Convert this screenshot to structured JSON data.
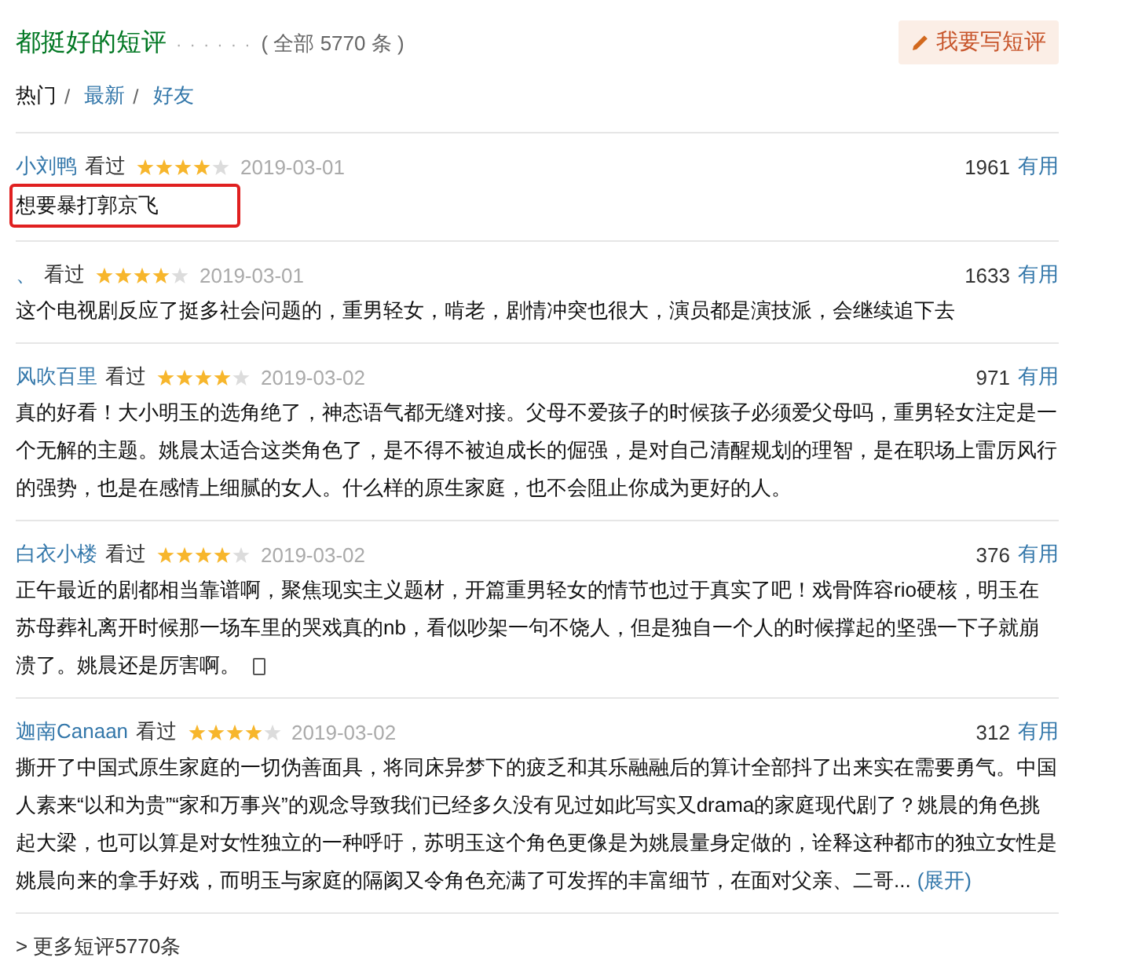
{
  "header": {
    "title": "都挺好的短评",
    "dots": "· · · · · ·",
    "count_link": "( 全部 5770 条 )",
    "write_button": "我要写短评"
  },
  "tabs": [
    {
      "label": "热门",
      "selected": true
    },
    {
      "label": "最新",
      "selected": false
    },
    {
      "label": "好友",
      "selected": false
    }
  ],
  "tab_separators": [
    "/",
    "/"
  ],
  "comments": [
    {
      "user": "小刘鸭",
      "status": "看过",
      "stars": 4,
      "date": "2019-03-01",
      "votes": "1961",
      "useful": "有用",
      "text": "想要暴打郭京飞",
      "highlighted": true
    },
    {
      "user": "、",
      "status": "看过",
      "stars": 4,
      "date": "2019-03-01",
      "votes": "1633",
      "useful": "有用",
      "text": "这个电视剧反应了挺多社会问题的，重男轻女，啃老，剧情冲突也很大，演员都是演技派，会继续追下去",
      "highlighted": false
    },
    {
      "user": "风吹百里",
      "status": "看过",
      "stars": 4,
      "date": "2019-03-02",
      "votes": "971",
      "useful": "有用",
      "text": "真的好看！大小明玉的选角绝了，神态语气都无缝对接。父母不爱孩子的时候孩子必须爱父母吗，重男轻女注定是一个无解的主题。姚晨太适合这类角色了，是不得不被迫成长的倔强，是对自己清醒规划的理智，是在职场上雷厉风行的强势，也是在感情上细腻的女人。什么样的原生家庭，也不会阻止你成为更好的人。",
      "highlighted": false
    },
    {
      "user": "白衣小楼",
      "status": "看过",
      "stars": 4,
      "date": "2019-03-02",
      "votes": "376",
      "useful": "有用",
      "text": "正午最近的剧都相当靠谱啊，聚焦现实主义题材，开篇重男轻女的情节也过于真实了吧！戏骨阵容rio硬核，明玉在苏母葬礼离开时候那一场车里的哭戏真的nb，看似吵架一句不饶人，但是独自一个人的时候撑起的坚强一下子就崩溃了。姚晨还是厉害啊。",
      "highlighted": false,
      "mobile": true
    },
    {
      "user": "迦南Canaan",
      "status": "看过",
      "stars": 4,
      "date": "2019-03-02",
      "votes": "312",
      "useful": "有用",
      "text": "撕开了中国式原生家庭的一切伪善面具，将同床异梦下的疲乏和其乐融融后的算计全部抖了出来实在需要勇气。中国人素来“以和为贵”“家和万事兴”的观念导致我们已经多久没有见过如此写实又drama的家庭现代剧了？姚晨的角色挑起大梁，也可以算是对女性独立的一种呼吁，苏明玉这个角色更像是为姚晨量身定做的，诠释这种都市的独立女性是姚晨向来的拿手好戏，而明玉与家庭的隔阂又令角色充满了可发挥的丰富细节，在面对父亲、二哥...",
      "expand": "(展开)",
      "highlighted": false
    }
  ],
  "more_link": "> 更多短评5770条"
}
